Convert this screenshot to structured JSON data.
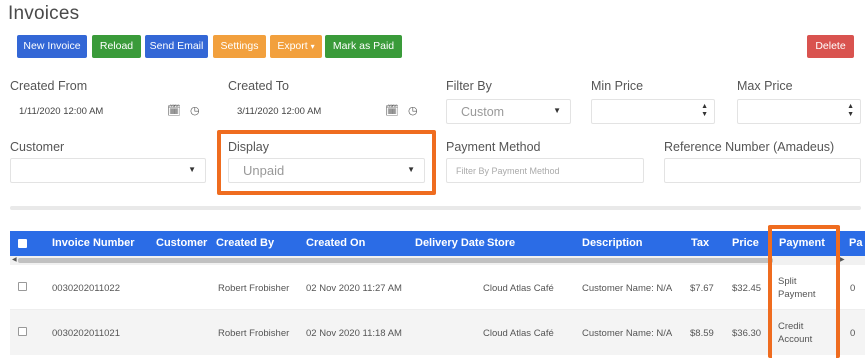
{
  "page": {
    "title": "Invoices"
  },
  "toolbar": {
    "new_invoice": "New Invoice",
    "reload": "Reload",
    "send_email": "Send Email",
    "settings": "Settings",
    "export": "Export",
    "mark_as_paid": "Mark as Paid",
    "delete": "Delete"
  },
  "filters": {
    "created_from": {
      "label": "Created From",
      "value": "1/11/2020 12:00 AM"
    },
    "created_to": {
      "label": "Created To",
      "value": "3/11/2020 12:00 AM"
    },
    "filter_by": {
      "label": "Filter By",
      "value": "Custom"
    },
    "min_price": {
      "label": "Min Price",
      "value": ""
    },
    "max_price": {
      "label": "Max Price",
      "value": ""
    },
    "customer": {
      "label": "Customer",
      "value": ""
    },
    "display": {
      "label": "Display",
      "value": "Unpaid"
    },
    "payment_method": {
      "label": "Payment Method",
      "placeholder": "Filter By Payment Method"
    },
    "reference_number": {
      "label": "Reference Number (Amadeus)",
      "value": ""
    }
  },
  "table": {
    "columns": [
      "Invoice Number",
      "Customer",
      "Created By",
      "Created On",
      "Delivery Date",
      "Store",
      "Description",
      "Tax",
      "Price",
      "Payment",
      "Pa"
    ],
    "rows": [
      {
        "invoice_number": "0030202011022",
        "customer": "",
        "created_by": "Robert Frobisher",
        "created_on": "02 Nov 2020 11:27 AM",
        "delivery_date": "",
        "store": "Cloud Atlas Café",
        "description": "Customer Name: N/A",
        "tax": "$7.67",
        "price": "$32.45",
        "payment_line1": "Split",
        "payment_line2": "Payment",
        "pa": "0"
      },
      {
        "invoice_number": "0030202011021",
        "customer": "",
        "created_by": "Robert Frobisher",
        "created_on": "02 Nov 2020 11:18 AM",
        "delivery_date": "",
        "store": "Cloud Atlas Café",
        "description": "Customer Name: N/A",
        "tax": "$8.59",
        "price": "$36.30",
        "payment_line1": "Credit",
        "payment_line2": "Account",
        "pa": "0"
      }
    ]
  },
  "colors": {
    "primary_blue": "#3367d6",
    "header_blue": "#2b6ce6",
    "green": "#3a9b3a",
    "orange": "#f2a03d",
    "red": "#d9534f",
    "highlight": "#ef6c1f"
  }
}
